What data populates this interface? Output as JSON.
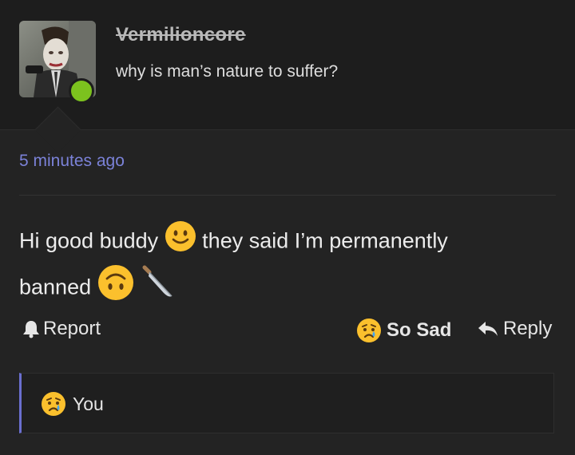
{
  "header": {
    "username": "Vermilioncore",
    "status": "why is man’s nature to suffer?"
  },
  "post": {
    "timestamp": "5 minutes ago",
    "message_part1": "Hi good buddy",
    "message_part2": "they said I’m permanently",
    "message_part3": "banned"
  },
  "actions": {
    "report_label": "Report",
    "reaction_label": "So Sad",
    "reply_label": "Reply"
  },
  "reactions": {
    "user_label": "You"
  },
  "colors": {
    "accent": "#7b82d8",
    "online": "#7cc21e",
    "background": "#232323"
  },
  "icons": [
    "bell-icon",
    "sad-face-emoji-icon",
    "reply-arrow-icon",
    "smiley-emoji-icon",
    "upside-down-face-emoji-icon",
    "knife-emoji-icon"
  ]
}
